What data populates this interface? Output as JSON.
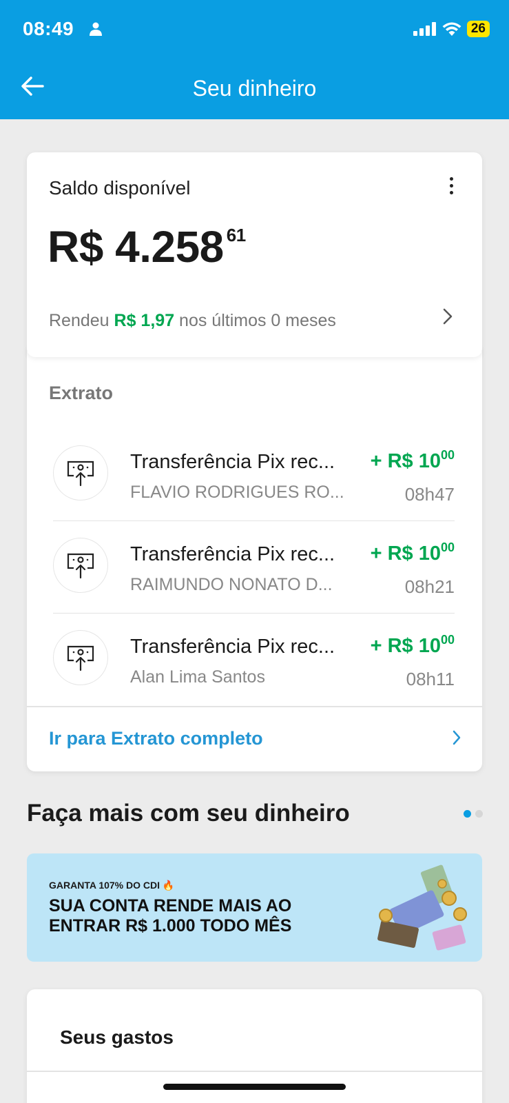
{
  "status_bar": {
    "time": "08:49",
    "battery": "26"
  },
  "nav": {
    "title": "Seu dinheiro"
  },
  "balance": {
    "label": "Saldo disponível",
    "amount": "R$ 4.258",
    "cents": "61",
    "yield_prefix": "Rendeu ",
    "yield_value": "R$ 1,97",
    "yield_suffix": " nos últimos 0 meses"
  },
  "extract": {
    "title": "Extrato",
    "transactions": [
      {
        "title": "Transferência Pix rec...",
        "subtitle": "FLAVIO RODRIGUES RO...",
        "amount": "+ R$ 10",
        "cents": "00",
        "time": "08h47"
      },
      {
        "title": "Transferência Pix rec...",
        "subtitle": "RAIMUNDO NONATO D...",
        "amount": "+ R$ 10",
        "cents": "00",
        "time": "08h21"
      },
      {
        "title": "Transferência Pix rec...",
        "subtitle": "Alan Lima Santos",
        "amount": "+ R$ 10",
        "cents": "00",
        "time": "08h11"
      }
    ],
    "link_label": "Ir para Extrato completo"
  },
  "promo_section": {
    "title": "Faça mais com seu dinheiro",
    "banner_kicker": "GARANTA 107% DO CDI 🔥",
    "banner_headline": "SUA CONTA RENDE MAIS AO ENTRAR R$ 1.000 TODO MÊS"
  },
  "spending": {
    "title": "Seus gastos"
  },
  "colors": {
    "brand": "#0a9ee2",
    "positive": "#00a650",
    "link": "#2596d4"
  }
}
